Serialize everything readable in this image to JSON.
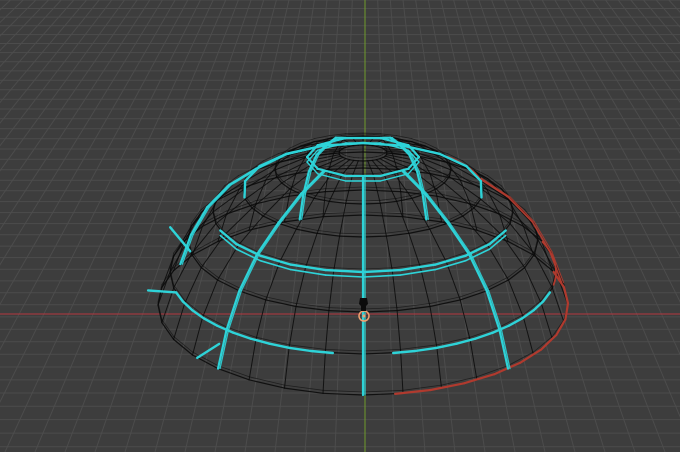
{
  "viewport": {
    "view_mode": "wireframe",
    "grid_visible": true,
    "object": "dome-mesh",
    "colors": {
      "background": "#3d3d3d",
      "grid_line": "#4c4c4c",
      "axis_x": "#b5363e",
      "axis_y": "#6f9a2c",
      "wire": "#0b0b0b",
      "seam_selected": "#2ed3d8",
      "seam_marked": "#b03a2e",
      "origin": "#f0a070"
    }
  }
}
